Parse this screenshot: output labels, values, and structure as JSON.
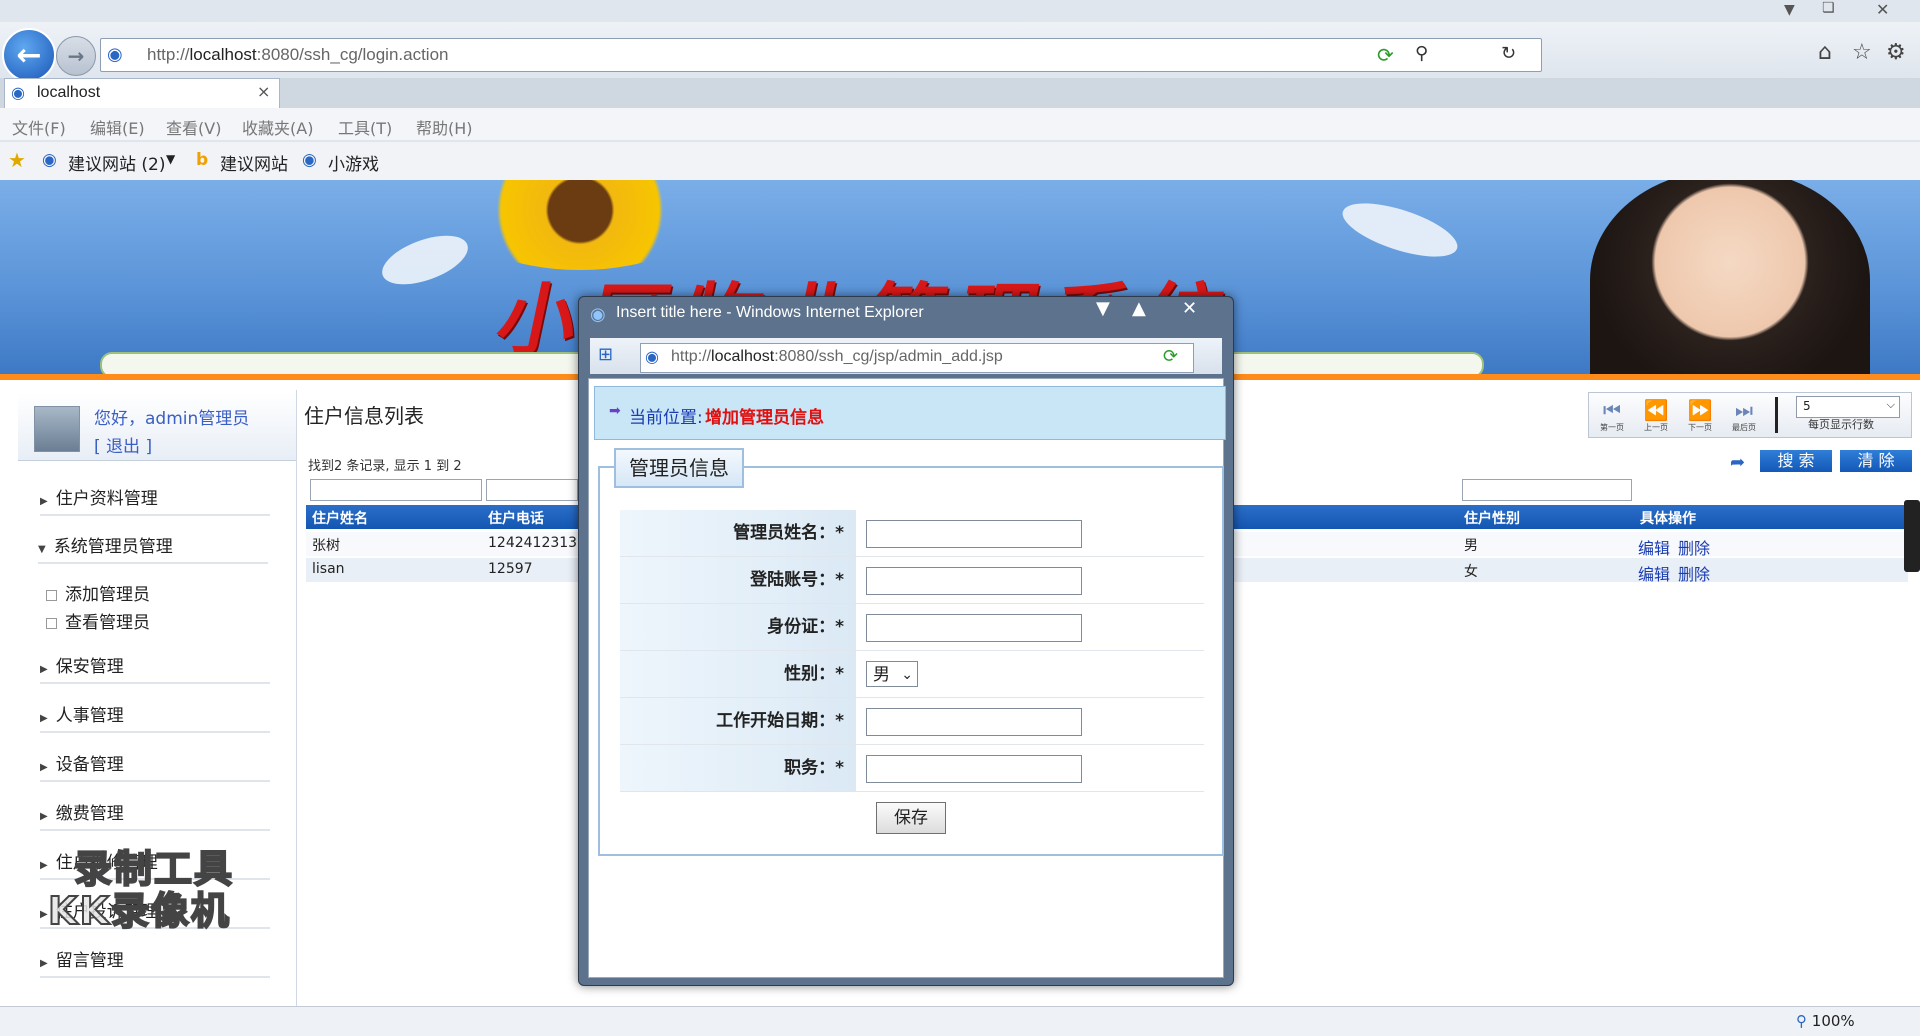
{
  "browser": {
    "url_prefix": "http://",
    "url_host": "localhost",
    "url_rest": ":8080/ssh_cg/login.action",
    "tab_label": "localhost",
    "tab_close": "×",
    "menu": [
      "文件(F)",
      "编辑(E)",
      "查看(V)",
      "收藏夹(A)",
      "工具(T)",
      "帮助(H)"
    ],
    "favorites": [
      "建议网站 (2)",
      "建议网站",
      "小游戏"
    ],
    "zoom": "100%"
  },
  "banner": {
    "title": "小区物业管理系统"
  },
  "sidebar": {
    "greeting": "您好，admin管理员",
    "logout": "[ 退出 ]",
    "items": [
      {
        "label": "住户资料管理",
        "expanded": false
      },
      {
        "label": "系统管理员管理",
        "expanded": true
      },
      {
        "label": "保安管理",
        "expanded": false
      },
      {
        "label": "人事管理",
        "expanded": false
      },
      {
        "label": "设备管理",
        "expanded": false
      },
      {
        "label": "缴费管理",
        "expanded": false
      },
      {
        "label": "住户报修管理",
        "expanded": false
      },
      {
        "label": "住户投诉管理",
        "expanded": false
      },
      {
        "label": "留言管理",
        "expanded": false
      }
    ],
    "subitems": [
      "添加管理员",
      "查看管理员"
    ]
  },
  "main": {
    "title": "住户信息列表",
    "records_text": "找到2 条记录, 显示 1 到 2",
    "pager": {
      "first": "第一页",
      "prev": "上一页",
      "next": "下一页",
      "last": "最后页",
      "rows_value": "5",
      "rows_label": "每页显示行数"
    },
    "search_label": "搜 索",
    "clear_label": "清 除",
    "columns": [
      "住户姓名",
      "住户电话",
      "住户性别",
      "具体操作"
    ],
    "rows": [
      {
        "name": "张树",
        "phone": "1242412313",
        "gender": "男",
        "edit": "编辑",
        "delete": "删除"
      },
      {
        "name": "lisan",
        "phone": "12597",
        "gender": "女",
        "edit": "编辑",
        "delete": "删除"
      }
    ]
  },
  "popup": {
    "title": "Insert title here - Windows Internet Explorer",
    "url_prefix": "http://",
    "url_host": "localhost",
    "url_rest": ":8080/ssh_cg/jsp/admin_add.jsp",
    "location_label": "当前位置:",
    "location_value": "增加管理员信息",
    "legend": "管理员信息",
    "fields": [
      {
        "label": "管理员姓名：*",
        "value": ""
      },
      {
        "label": "登陆账号：*",
        "value": ""
      },
      {
        "label": "身份证：*",
        "value": ""
      },
      {
        "label": "性别：*",
        "value": "男"
      },
      {
        "label": "工作开始日期：*",
        "value": ""
      },
      {
        "label": "职务：*",
        "value": ""
      }
    ],
    "save_label": "保存"
  },
  "watermark": {
    "line1": "录制工具",
    "line2": "KK录像机"
  },
  "colors": {
    "accent_blue": "#1457b2",
    "banner_title_red": "#d81818",
    "location_red": "#e01010"
  }
}
